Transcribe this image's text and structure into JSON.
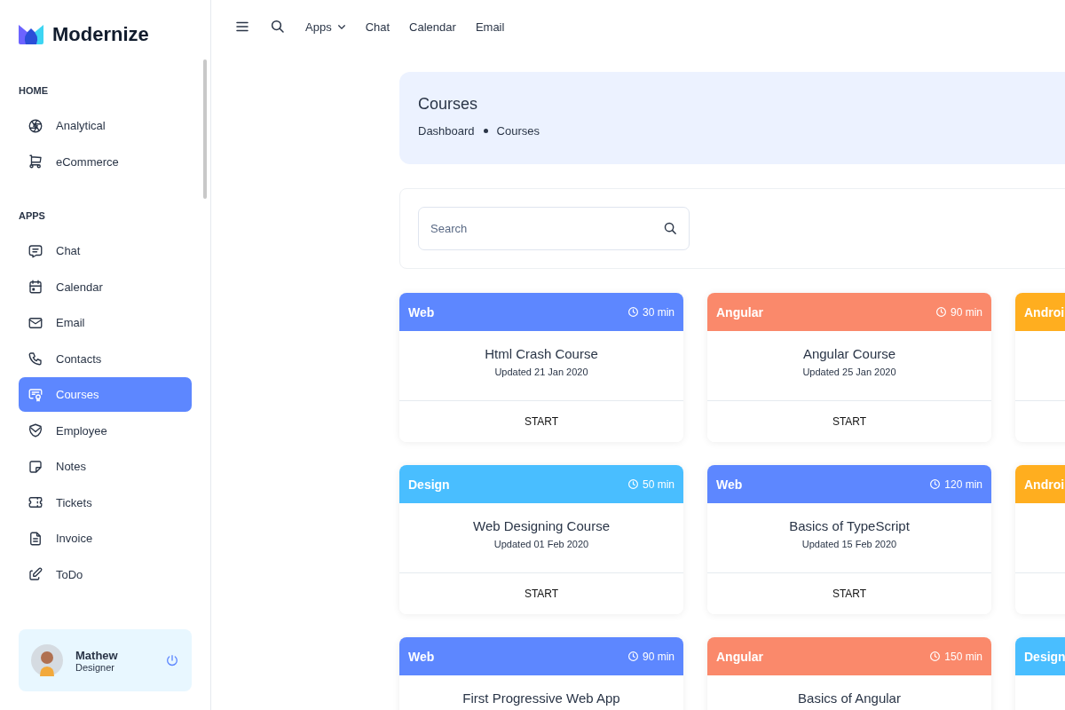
{
  "logo": {
    "text": "Modernize"
  },
  "topbar": {
    "links": [
      {
        "label": "Apps",
        "dropdown": true
      },
      {
        "label": "Chat",
        "dropdown": false
      },
      {
        "label": "Calendar",
        "dropdown": false
      },
      {
        "label": "Email",
        "dropdown": false
      }
    ]
  },
  "sidebar": {
    "sections": [
      {
        "title": "HOME",
        "items": [
          {
            "label": "Analytical",
            "selected": false
          },
          {
            "label": "eCommerce",
            "selected": false
          }
        ]
      },
      {
        "title": "APPS",
        "items": [
          {
            "label": "Chat",
            "selected": false
          },
          {
            "label": "Calendar",
            "selected": false
          },
          {
            "label": "Email",
            "selected": false
          },
          {
            "label": "Contacts",
            "selected": false
          },
          {
            "label": "Courses",
            "selected": true
          },
          {
            "label": "Employee",
            "selected": false
          },
          {
            "label": "Notes",
            "selected": false
          },
          {
            "label": "Tickets",
            "selected": false
          },
          {
            "label": "Invoice",
            "selected": false
          },
          {
            "label": "ToDo",
            "selected": false
          }
        ]
      }
    ]
  },
  "profile": {
    "name": "Mathew",
    "role": "Designer"
  },
  "header": {
    "title": "Courses",
    "breadcrumb": [
      "Dashboard",
      "Courses"
    ]
  },
  "search": {
    "placeholder": "Search"
  },
  "courses": [
    {
      "category": "Web",
      "color": "#5d87ff",
      "duration": "30 min",
      "title": "Html Crash Course",
      "updated": "Updated 21 Jan 2020",
      "button": "START"
    },
    {
      "category": "Angular",
      "color": "#fa896b",
      "duration": "90 min",
      "title": "Angular Course",
      "updated": "Updated 25 Jan 2020",
      "button": "START"
    },
    {
      "category": "Androi",
      "color": "#ffae1f"
    },
    {
      "category": "Design",
      "color": "#49beff",
      "duration": "50 min",
      "title": "Web Designing Course",
      "updated": "Updated 01 Feb 2020",
      "button": "START"
    },
    {
      "category": "Web",
      "color": "#5d87ff",
      "duration": "120 min",
      "title": "Basics of TypeScript",
      "updated": "Updated 15 Feb 2020",
      "button": "START"
    },
    {
      "category": "Androi",
      "color": "#ffae1f"
    },
    {
      "category": "Web",
      "color": "#5d87ff",
      "duration": "90 min",
      "title": "First Progressive Web App"
    },
    {
      "category": "Angular",
      "color": "#fa896b",
      "duration": "150 min",
      "title": "Basics of Angular"
    },
    {
      "category": "Design",
      "color": "#49beff"
    }
  ]
}
